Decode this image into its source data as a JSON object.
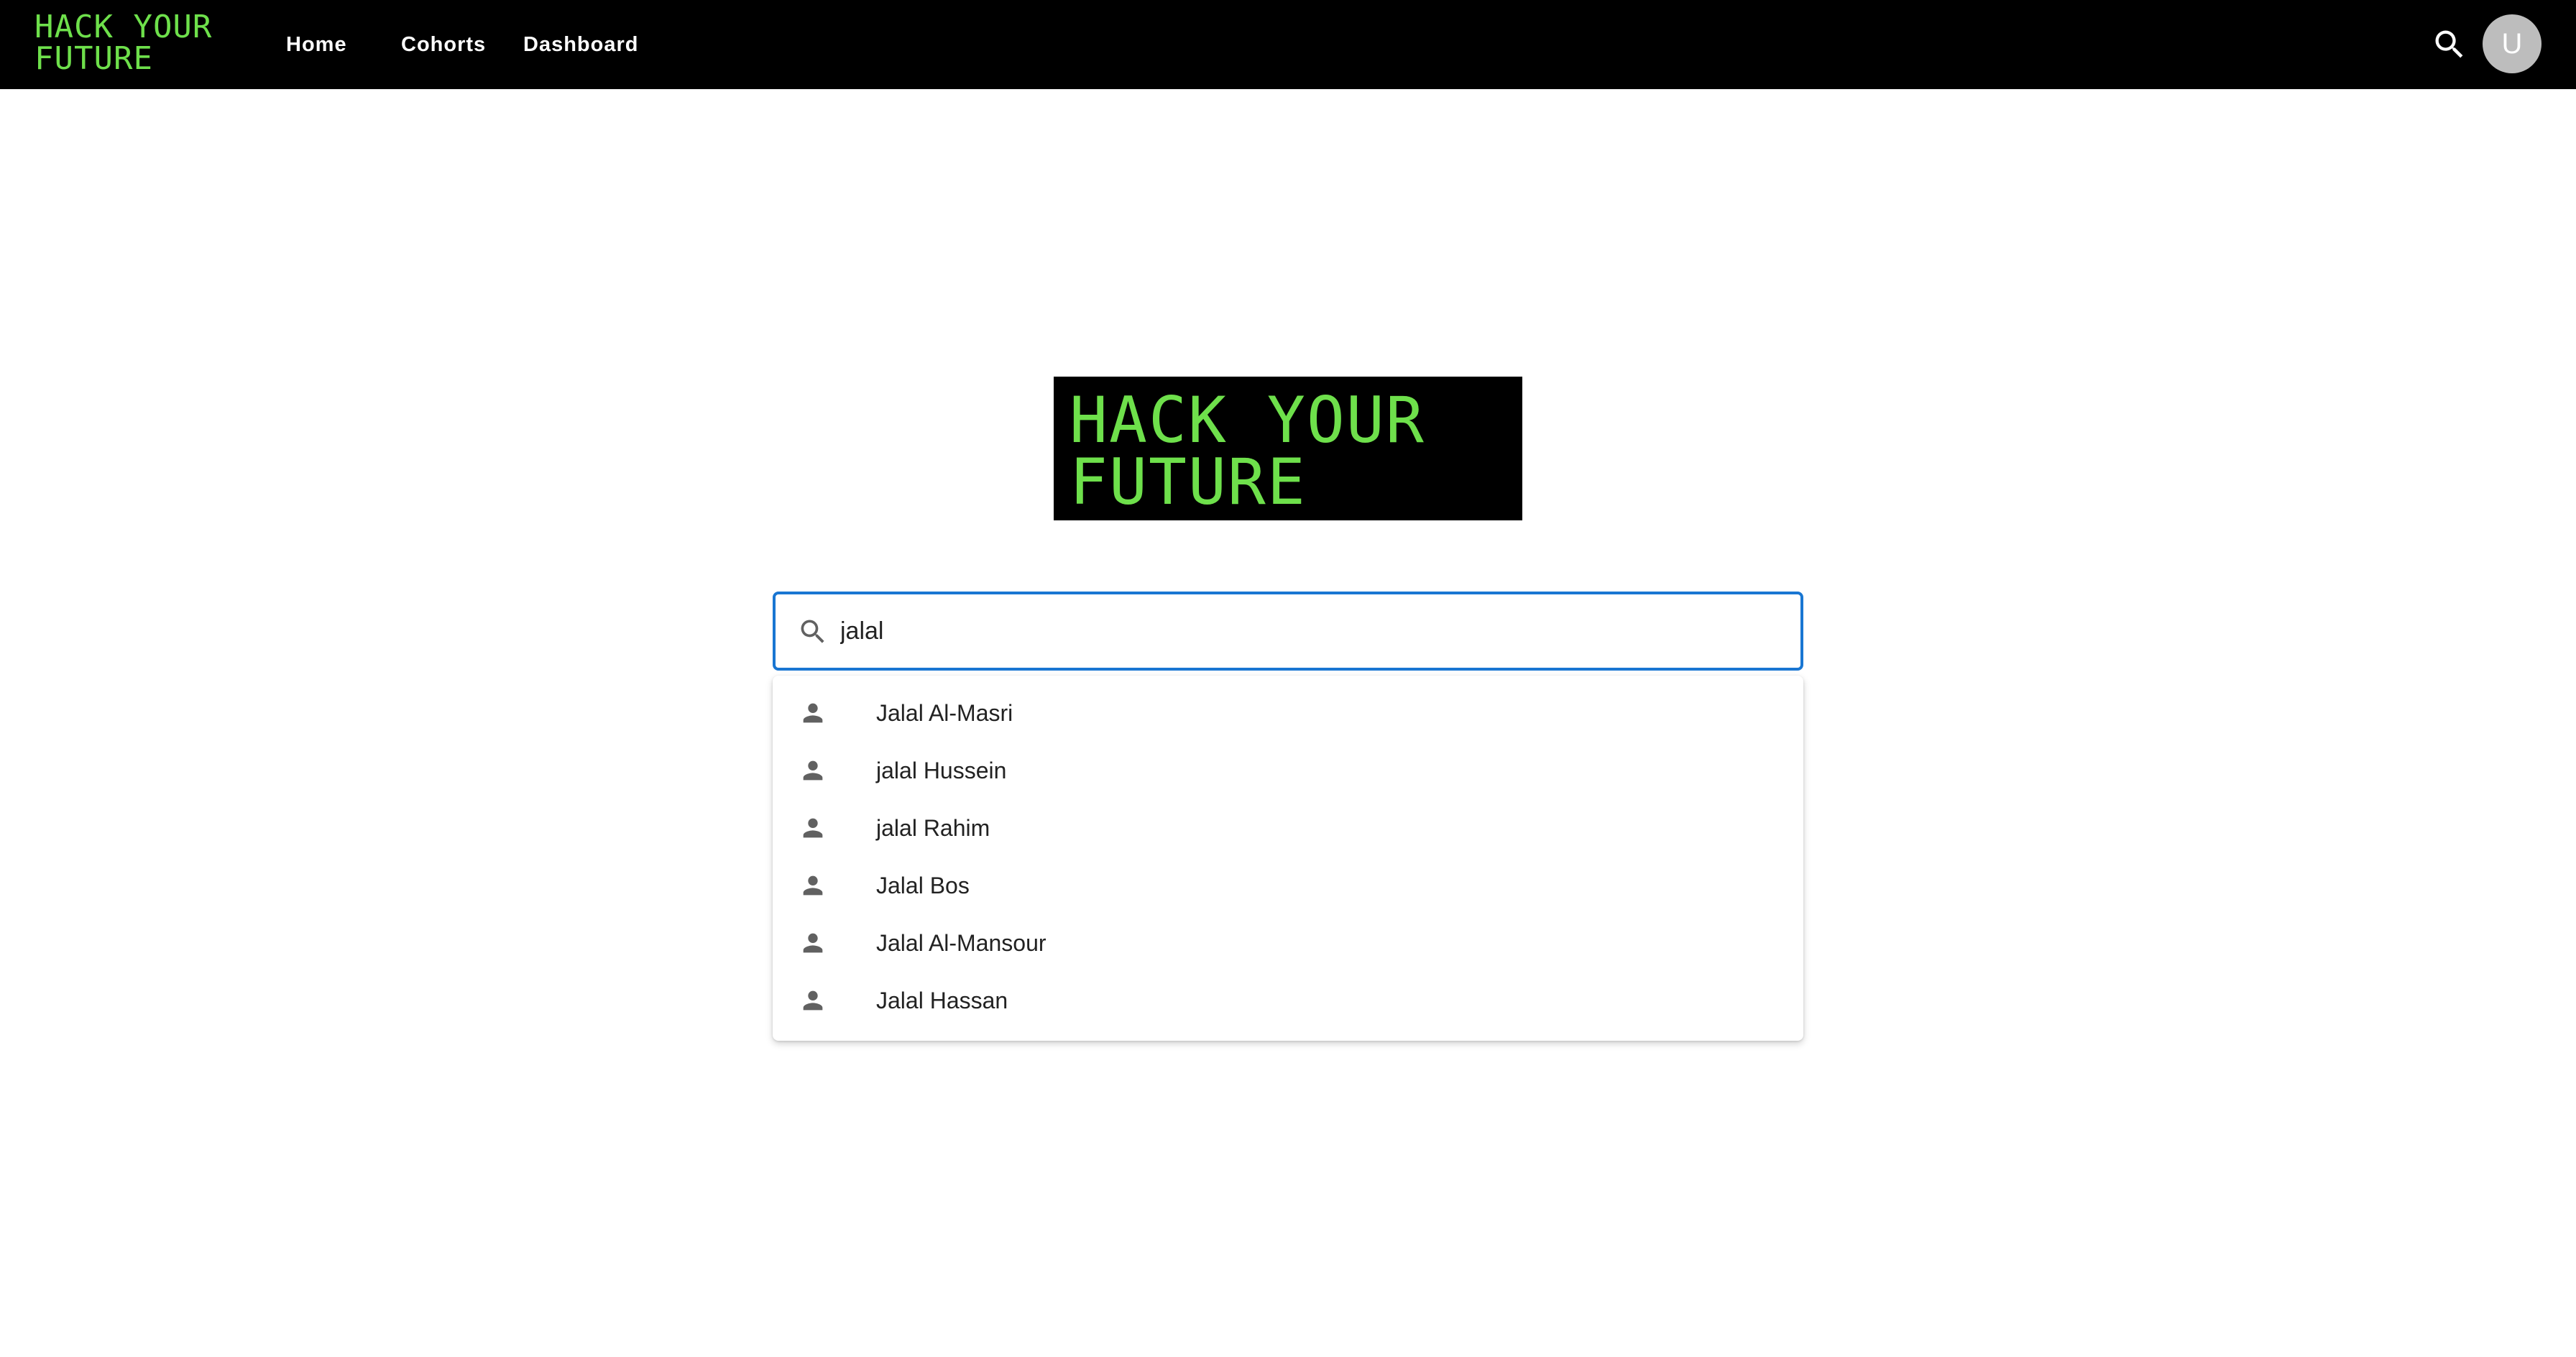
{
  "nav": {
    "logo_line1": "HACK YOUR",
    "logo_line2": "FUTURE",
    "links": [
      "Home",
      "Cohorts",
      "Dashboard"
    ],
    "search_icon": "search-icon",
    "avatar_letter": "U"
  },
  "hero": {
    "logo_line1": "HACK YOUR",
    "logo_line2": "FUTURE"
  },
  "search": {
    "value": "jalal",
    "icon": "search-icon"
  },
  "results": {
    "icon": "person-icon",
    "items": [
      "Jalal Al-Masri",
      "jalal Hussein",
      "jalal Rahim",
      "Jalal Bos",
      "Jalal Al-Mansour",
      "Jalal Hassan"
    ]
  },
  "colors": {
    "brand_green": "#6ee04b",
    "nav_bg": "#000000",
    "focus_blue": "#1976d2",
    "avatar_bg": "#bdbdbd"
  }
}
